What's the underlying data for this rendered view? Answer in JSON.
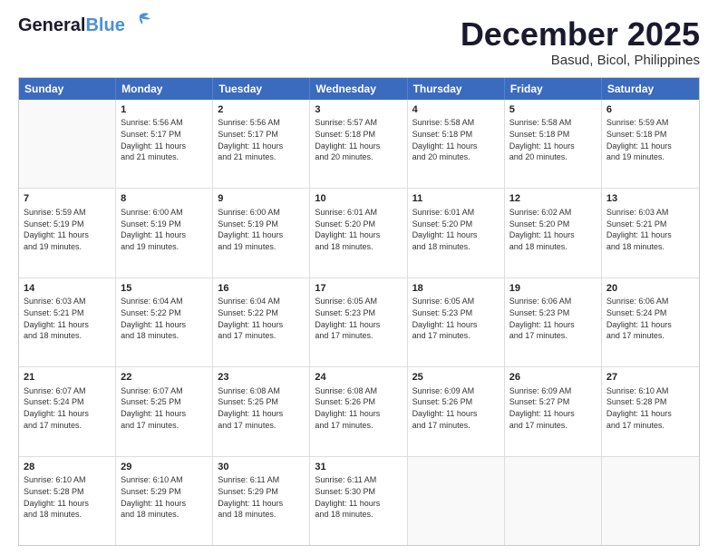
{
  "logo": {
    "line1": "General",
    "line2": "Blue"
  },
  "title": "December 2025",
  "subtitle": "Basud, Bicol, Philippines",
  "header": {
    "days": [
      "Sunday",
      "Monday",
      "Tuesday",
      "Wednesday",
      "Thursday",
      "Friday",
      "Saturday"
    ]
  },
  "weeks": [
    [
      {
        "day": "",
        "info": ""
      },
      {
        "day": "1",
        "info": "Sunrise: 5:56 AM\nSunset: 5:17 PM\nDaylight: 11 hours\nand 21 minutes."
      },
      {
        "day": "2",
        "info": "Sunrise: 5:56 AM\nSunset: 5:17 PM\nDaylight: 11 hours\nand 21 minutes."
      },
      {
        "day": "3",
        "info": "Sunrise: 5:57 AM\nSunset: 5:18 PM\nDaylight: 11 hours\nand 20 minutes."
      },
      {
        "day": "4",
        "info": "Sunrise: 5:58 AM\nSunset: 5:18 PM\nDaylight: 11 hours\nand 20 minutes."
      },
      {
        "day": "5",
        "info": "Sunrise: 5:58 AM\nSunset: 5:18 PM\nDaylight: 11 hours\nand 20 minutes."
      },
      {
        "day": "6",
        "info": "Sunrise: 5:59 AM\nSunset: 5:18 PM\nDaylight: 11 hours\nand 19 minutes."
      }
    ],
    [
      {
        "day": "7",
        "info": "Sunrise: 5:59 AM\nSunset: 5:19 PM\nDaylight: 11 hours\nand 19 minutes."
      },
      {
        "day": "8",
        "info": "Sunrise: 6:00 AM\nSunset: 5:19 PM\nDaylight: 11 hours\nand 19 minutes."
      },
      {
        "day": "9",
        "info": "Sunrise: 6:00 AM\nSunset: 5:19 PM\nDaylight: 11 hours\nand 19 minutes."
      },
      {
        "day": "10",
        "info": "Sunrise: 6:01 AM\nSunset: 5:20 PM\nDaylight: 11 hours\nand 18 minutes."
      },
      {
        "day": "11",
        "info": "Sunrise: 6:01 AM\nSunset: 5:20 PM\nDaylight: 11 hours\nand 18 minutes."
      },
      {
        "day": "12",
        "info": "Sunrise: 6:02 AM\nSunset: 5:20 PM\nDaylight: 11 hours\nand 18 minutes."
      },
      {
        "day": "13",
        "info": "Sunrise: 6:03 AM\nSunset: 5:21 PM\nDaylight: 11 hours\nand 18 minutes."
      }
    ],
    [
      {
        "day": "14",
        "info": "Sunrise: 6:03 AM\nSunset: 5:21 PM\nDaylight: 11 hours\nand 18 minutes."
      },
      {
        "day": "15",
        "info": "Sunrise: 6:04 AM\nSunset: 5:22 PM\nDaylight: 11 hours\nand 18 minutes."
      },
      {
        "day": "16",
        "info": "Sunrise: 6:04 AM\nSunset: 5:22 PM\nDaylight: 11 hours\nand 17 minutes."
      },
      {
        "day": "17",
        "info": "Sunrise: 6:05 AM\nSunset: 5:23 PM\nDaylight: 11 hours\nand 17 minutes."
      },
      {
        "day": "18",
        "info": "Sunrise: 6:05 AM\nSunset: 5:23 PM\nDaylight: 11 hours\nand 17 minutes."
      },
      {
        "day": "19",
        "info": "Sunrise: 6:06 AM\nSunset: 5:23 PM\nDaylight: 11 hours\nand 17 minutes."
      },
      {
        "day": "20",
        "info": "Sunrise: 6:06 AM\nSunset: 5:24 PM\nDaylight: 11 hours\nand 17 minutes."
      }
    ],
    [
      {
        "day": "21",
        "info": "Sunrise: 6:07 AM\nSunset: 5:24 PM\nDaylight: 11 hours\nand 17 minutes."
      },
      {
        "day": "22",
        "info": "Sunrise: 6:07 AM\nSunset: 5:25 PM\nDaylight: 11 hours\nand 17 minutes."
      },
      {
        "day": "23",
        "info": "Sunrise: 6:08 AM\nSunset: 5:25 PM\nDaylight: 11 hours\nand 17 minutes."
      },
      {
        "day": "24",
        "info": "Sunrise: 6:08 AM\nSunset: 5:26 PM\nDaylight: 11 hours\nand 17 minutes."
      },
      {
        "day": "25",
        "info": "Sunrise: 6:09 AM\nSunset: 5:26 PM\nDaylight: 11 hours\nand 17 minutes."
      },
      {
        "day": "26",
        "info": "Sunrise: 6:09 AM\nSunset: 5:27 PM\nDaylight: 11 hours\nand 17 minutes."
      },
      {
        "day": "27",
        "info": "Sunrise: 6:10 AM\nSunset: 5:28 PM\nDaylight: 11 hours\nand 17 minutes."
      }
    ],
    [
      {
        "day": "28",
        "info": "Sunrise: 6:10 AM\nSunset: 5:28 PM\nDaylight: 11 hours\nand 18 minutes."
      },
      {
        "day": "29",
        "info": "Sunrise: 6:10 AM\nSunset: 5:29 PM\nDaylight: 11 hours\nand 18 minutes."
      },
      {
        "day": "30",
        "info": "Sunrise: 6:11 AM\nSunset: 5:29 PM\nDaylight: 11 hours\nand 18 minutes."
      },
      {
        "day": "31",
        "info": "Sunrise: 6:11 AM\nSunset: 5:30 PM\nDaylight: 11 hours\nand 18 minutes."
      },
      {
        "day": "",
        "info": ""
      },
      {
        "day": "",
        "info": ""
      },
      {
        "day": "",
        "info": ""
      }
    ]
  ]
}
